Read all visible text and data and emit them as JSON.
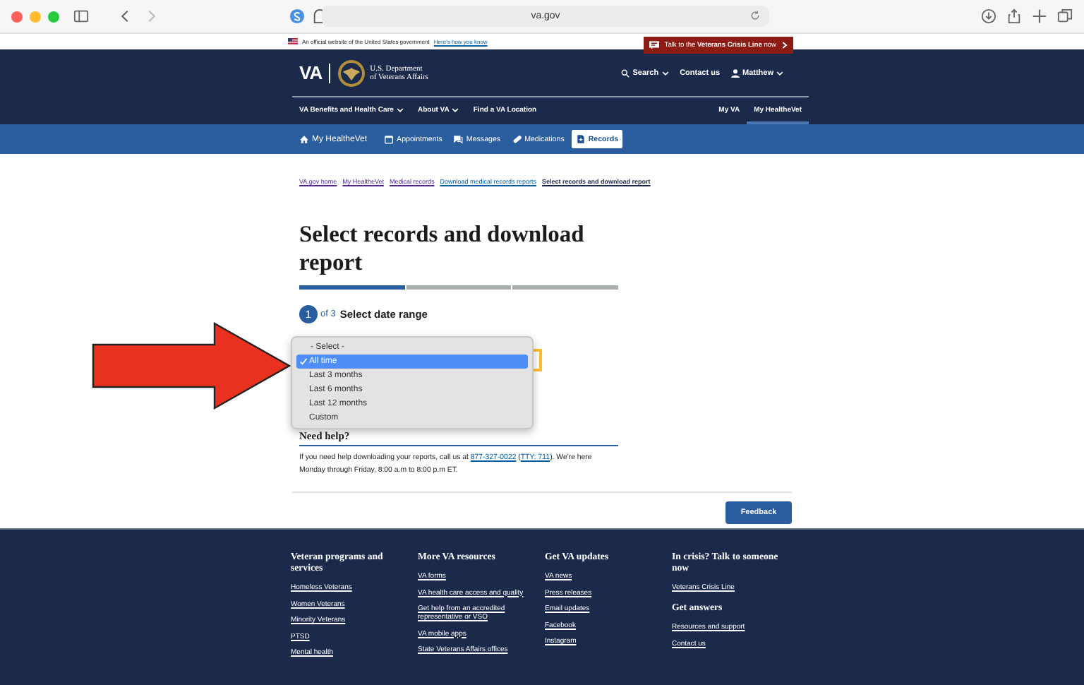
{
  "browser": {
    "url": "va.gov"
  },
  "banner": {
    "text": "An official website of the United States government",
    "link": "Here's how you know"
  },
  "crisis_button": {
    "text": "Talk to the **Veterans Crisis Line** now"
  },
  "header": {
    "logo": "VA",
    "department": [
      "U.S. Department",
      "of Veterans Affairs"
    ],
    "search": "Search",
    "contact": "Contact us",
    "user": "Matthew"
  },
  "main_nav": {
    "left": [
      {
        "label": "VA Benefits and Health Care",
        "has_menu": true,
        "selected": false
      },
      {
        "label": "About VA",
        "has_menu": true,
        "selected": false
      },
      {
        "label": "Find a VA Location",
        "has_menu": false,
        "selected": false
      }
    ],
    "right": [
      {
        "label": "My VA",
        "has_menu": false,
        "selected": false
      },
      {
        "label": "My HealtheVet",
        "has_menu": false,
        "selected": true
      }
    ]
  },
  "sub_nav": [
    {
      "label": "My HealtheVet",
      "kind": "home",
      "selected": false
    },
    {
      "label": "Appointments",
      "kind": "calendar",
      "selected": false
    },
    {
      "label": "Messages",
      "kind": "chat",
      "selected": false
    },
    {
      "label": "Medications",
      "kind": "pill",
      "selected": false
    },
    {
      "label": "Records",
      "kind": "document",
      "selected": true
    }
  ],
  "breadcrumbs": [
    {
      "label": "VA.gov home",
      "visited": true,
      "current": false
    },
    {
      "label": "My HealtheVet",
      "visited": true,
      "current": false
    },
    {
      "label": "Medical records",
      "visited": true,
      "current": false
    },
    {
      "label": "Download medical records reports",
      "visited": false,
      "current": false
    },
    {
      "label": "Select records and download report",
      "current": true
    }
  ],
  "title": "Select records and download report",
  "progress": [
    {
      "selected": true
    },
    {
      "selected": false
    },
    {
      "selected": false
    }
  ],
  "step": {
    "number": "1",
    "of": "of 3",
    "label": "Select date range"
  },
  "dropdown": {
    "options": [
      {
        "label": "- Select -",
        "selected": false
      },
      {
        "label": "All time",
        "selected": true
      },
      {
        "label": "Last 3 months",
        "selected": false
      },
      {
        "label": "Last 6 months",
        "selected": false
      },
      {
        "label": "Last 12 months",
        "selected": false
      },
      {
        "label": "Custom",
        "selected": false
      }
    ]
  },
  "help": {
    "heading": "Need help?",
    "parts": [
      {
        "kind": "text",
        "text": "If you need help downloading your reports, call us at "
      },
      {
        "kind": "link",
        "text": "877-327-0022"
      },
      {
        "kind": "text",
        "text": " ("
      },
      {
        "kind": "link",
        "text": "TTY: 711"
      },
      {
        "kind": "text",
        "text": "). We're here Monday through Friday, 8:00 a.m to 8:00 p.m ET."
      }
    ]
  },
  "feedback_button": "Feedback",
  "footer": {
    "columns": [
      {
        "heading": "Veteran programs and services",
        "links": [
          "Homeless Veterans",
          "Women Veterans",
          "Minority Veterans",
          "PTSD",
          "Mental health"
        ]
      },
      {
        "heading": "More VA resources",
        "links": [
          "VA forms",
          "VA health care access and quality",
          "Get help from an accredited representative or VSO",
          "VA mobile apps",
          "State Veterans Affairs offices"
        ]
      },
      {
        "heading": "Get VA updates",
        "links": [
          "VA news",
          "Press releases",
          "Email updates",
          "Facebook",
          "Instagram"
        ]
      },
      {
        "heading": "In crisis? Talk to someone now",
        "links": [
          "Veterans Crisis Line"
        ],
        "subheading": "Get answers",
        "more_links": [
          "Resources and support",
          "Contact us"
        ]
      }
    ]
  }
}
